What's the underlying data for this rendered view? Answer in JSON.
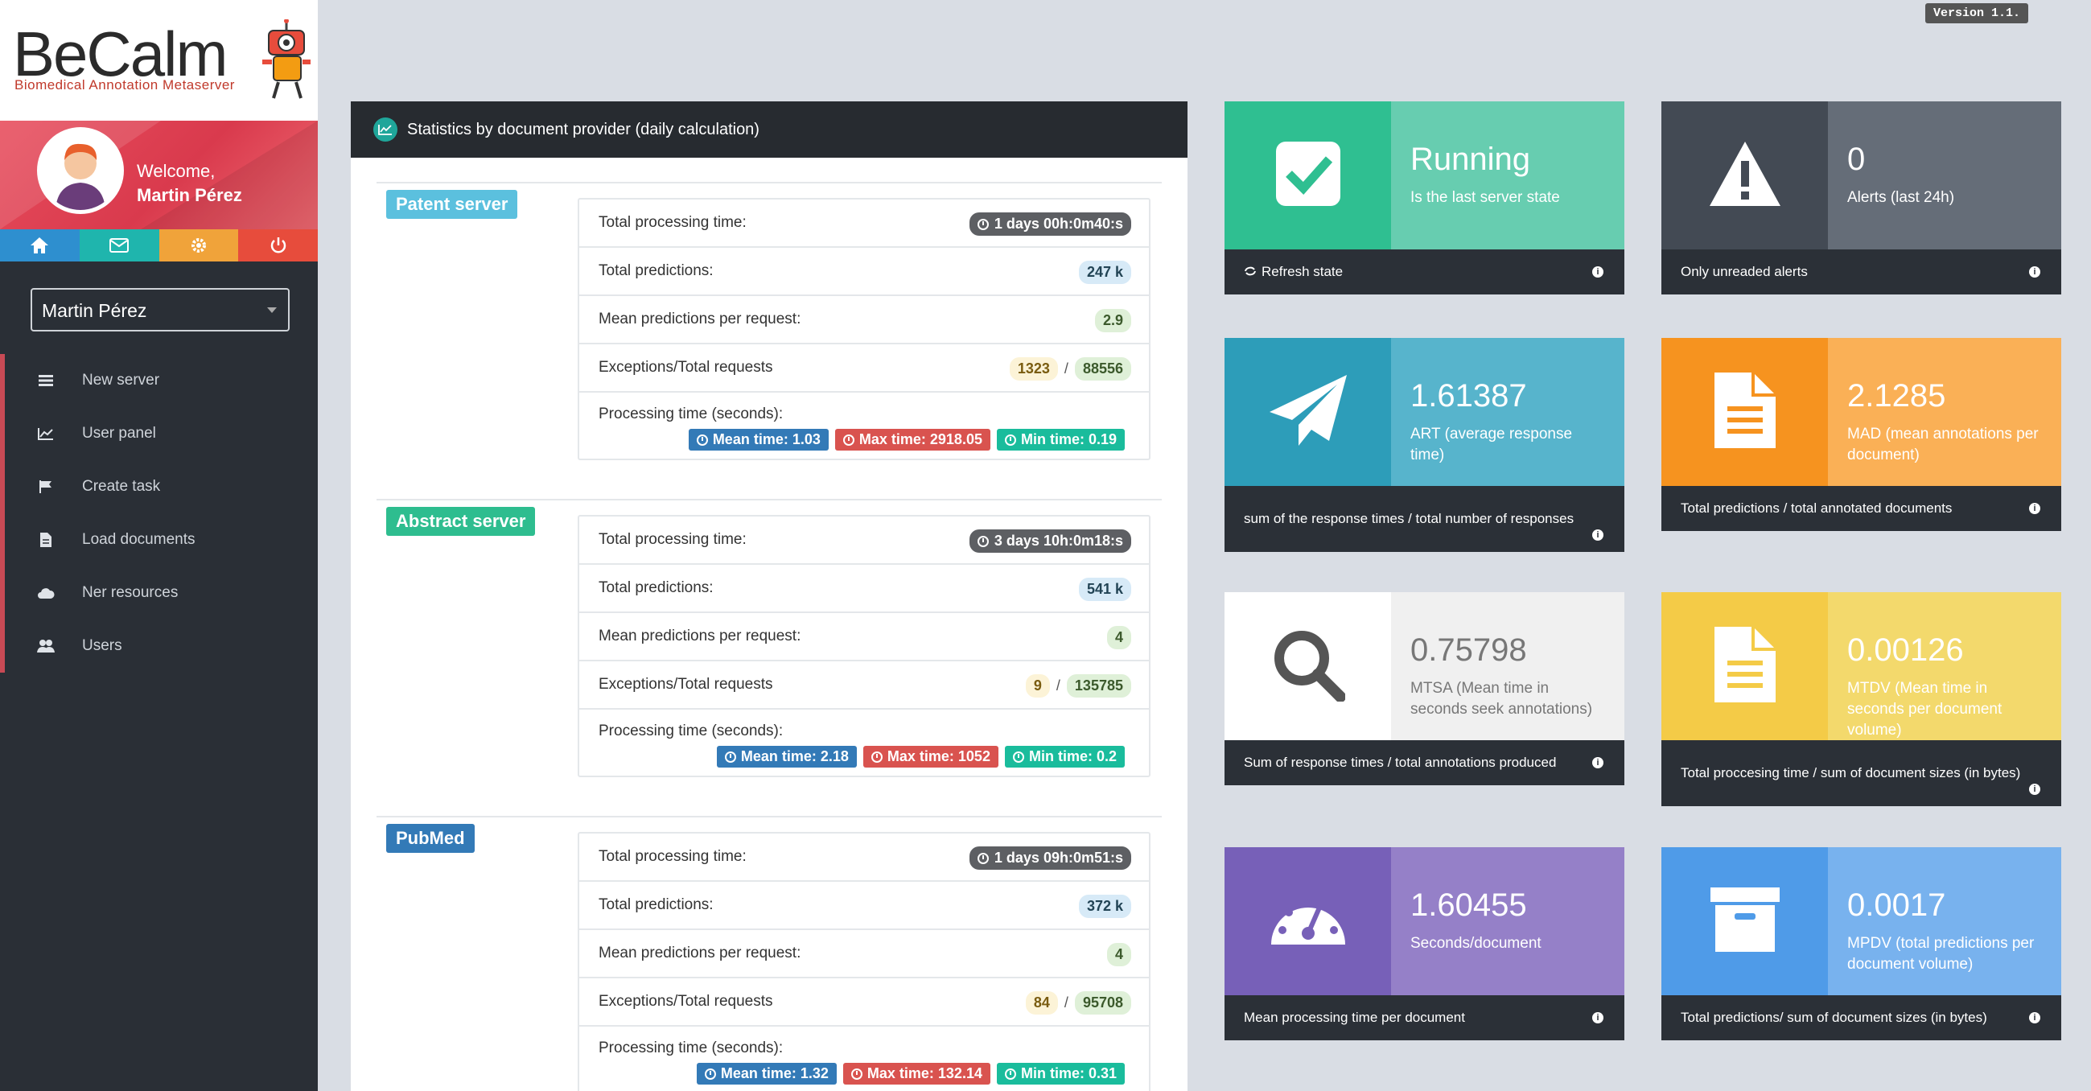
{
  "app": {
    "logo_text": "BeCalm",
    "logo_subtitle": "Biomedical Annotation Metaserver",
    "version": "Version 1.1."
  },
  "profile": {
    "welcome": "Welcome,",
    "name": "Martin Pérez"
  },
  "quick_icons": [
    {
      "icon": "home-icon",
      "color": "#2e8fcf"
    },
    {
      "icon": "envelope-icon",
      "color": "#1fb5ad"
    },
    {
      "icon": "gear-icon",
      "color": "#f0a33a"
    },
    {
      "icon": "power-icon",
      "color": "#e74c3c"
    }
  ],
  "user_select": {
    "value": "Martin Pérez"
  },
  "menu": [
    {
      "label": "New server",
      "icon": "list-icon"
    },
    {
      "label": "User panel",
      "icon": "line-chart-icon"
    },
    {
      "label": "Create task",
      "icon": "flag-icon"
    },
    {
      "label": "Load documents",
      "icon": "document-icon"
    },
    {
      "label": "Ner resources",
      "icon": "cloud-icon"
    },
    {
      "label": "Users",
      "icon": "users-icon"
    }
  ],
  "stats": {
    "title": "Statistics by document provider (daily calculation)",
    "labels": {
      "total_time": "Total processing time:",
      "total_pred": "Total predictions:",
      "mean_pred": "Mean predictions per request:",
      "exceptions": "Exceptions/Total requests",
      "proc_time": "Processing time (seconds):"
    },
    "servers": [
      {
        "name": "Patent server",
        "color": "#5bc0de",
        "total_time": "1 days 00h:0m40:s",
        "total_predictions": "247 k",
        "mean_predictions": "2.9",
        "exceptions": "1323",
        "total_requests": "88556",
        "mean_time": "Mean time: 1.03",
        "max_time": "Max time: 2918.05",
        "min_time": "Min time: 0.19"
      },
      {
        "name": "Abstract server",
        "color": "#2ebd8f",
        "total_time": "3 days 10h:0m18:s",
        "total_predictions": "541 k",
        "mean_predictions": "4",
        "exceptions": "9",
        "total_requests": "135785",
        "mean_time": "Mean time: 2.18",
        "max_time": "Max time: 1052",
        "min_time": "Min time: 0.2"
      },
      {
        "name": "PubMed",
        "color": "#337ab7",
        "total_time": "1 days 09h:0m51:s",
        "total_predictions": "372 k",
        "mean_predictions": "4",
        "exceptions": "84",
        "total_requests": "95708",
        "mean_time": "Mean time: 1.32",
        "max_time": "Max time: 132.14",
        "min_time": "Min time: 0.31"
      }
    ]
  },
  "cards": [
    {
      "value": "Running",
      "sub": "Is the last server state",
      "foot": "Refresh state",
      "icon": "checkbox-icon",
      "left": "#2fbf91",
      "right": "#67cdb0"
    },
    {
      "value": "0",
      "sub": "Alerts (last 24h)",
      "foot": "Only unreaded alerts",
      "icon": "warning-icon",
      "left": "#434a54",
      "right": "#656d78"
    },
    {
      "value": "1.61387",
      "sub": "ART (average response time)",
      "foot": "sum of the response times / total number of responses",
      "icon": "paper-plane-icon",
      "left": "#2d9db9",
      "right": "#57b4cc"
    },
    {
      "value": "2.1285",
      "sub": "MAD (mean annotations per document)",
      "foot": "Total predictions / total annotated documents",
      "icon": "file-text-icon",
      "left": "#f6931f",
      "right": "#fab056"
    },
    {
      "value": "0.75798",
      "sub": "MTSA (Mean time in seconds seek annotations)",
      "foot": "Sum of response times / total annotations produced",
      "icon": "search-icon",
      "left": "#ffffff",
      "right": "#f0f0f0"
    },
    {
      "value": "0.00126",
      "sub": "MTDV (Mean time in seconds per document volume)",
      "foot": "Total proccesing time / sum of document sizes (in bytes)",
      "icon": "file-text-icon",
      "left": "#f4cb47",
      "right": "#f3d96c"
    },
    {
      "value": "1.60455",
      "sub": "Seconds/document",
      "foot": "Mean processing time per document",
      "icon": "dashboard-icon",
      "left": "#7760b8",
      "right": "#9580c8"
    },
    {
      "value": "0.0017",
      "sub": "MPDV (total predictions per document volume)",
      "foot": "Total predictions/ sum of document sizes (in bytes)",
      "icon": "archive-icon",
      "left": "#4f9be8",
      "right": "#78b2ee"
    }
  ]
}
